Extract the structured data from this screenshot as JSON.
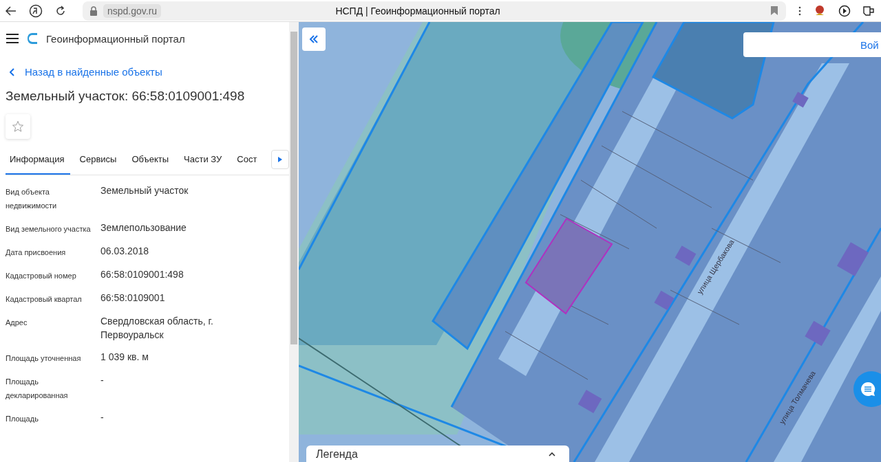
{
  "browser": {
    "url": "nspd.gov.ru",
    "title": "НСПД | Геоинформационный портал"
  },
  "app": {
    "title": "Геоинформационный портал"
  },
  "back_link": "Назад в найденные объекты",
  "heading": "Земельный участок: 66:58:0109001:498",
  "favorite": {
    "on": false
  },
  "tabs": [
    {
      "label": "Информация",
      "selected": true
    },
    {
      "label": "Сервисы",
      "selected": false
    },
    {
      "label": "Объекты",
      "selected": false
    },
    {
      "label": "Части ЗУ",
      "selected": false
    },
    {
      "label": "Сост",
      "selected": false
    }
  ],
  "properties": [
    {
      "label": "Вид объекта недвижимости",
      "value": "Земельный участок"
    },
    {
      "label": "Вид земельного участка",
      "value": "Землепользование"
    },
    {
      "label": "Дата присвоения",
      "value": "06.03.2018"
    },
    {
      "label": "Кадастровый номер",
      "value": "66:58:0109001:498"
    },
    {
      "label": "Кадастровый квартал",
      "value": "66:58:0109001"
    },
    {
      "label": "Адрес",
      "value": "Свердловская область, г. Первоуральск"
    },
    {
      "label": "Площадь уточненная",
      "value": "1 039 кв. м"
    },
    {
      "label": "Площадь декларированная",
      "value": "-"
    },
    {
      "label": "Площадь",
      "value": "-"
    }
  ],
  "map": {
    "login_button": "Вой",
    "legend": "Легенда",
    "street_labels": [
      "улица Щербакова",
      "улица Толмачева"
    ]
  }
}
